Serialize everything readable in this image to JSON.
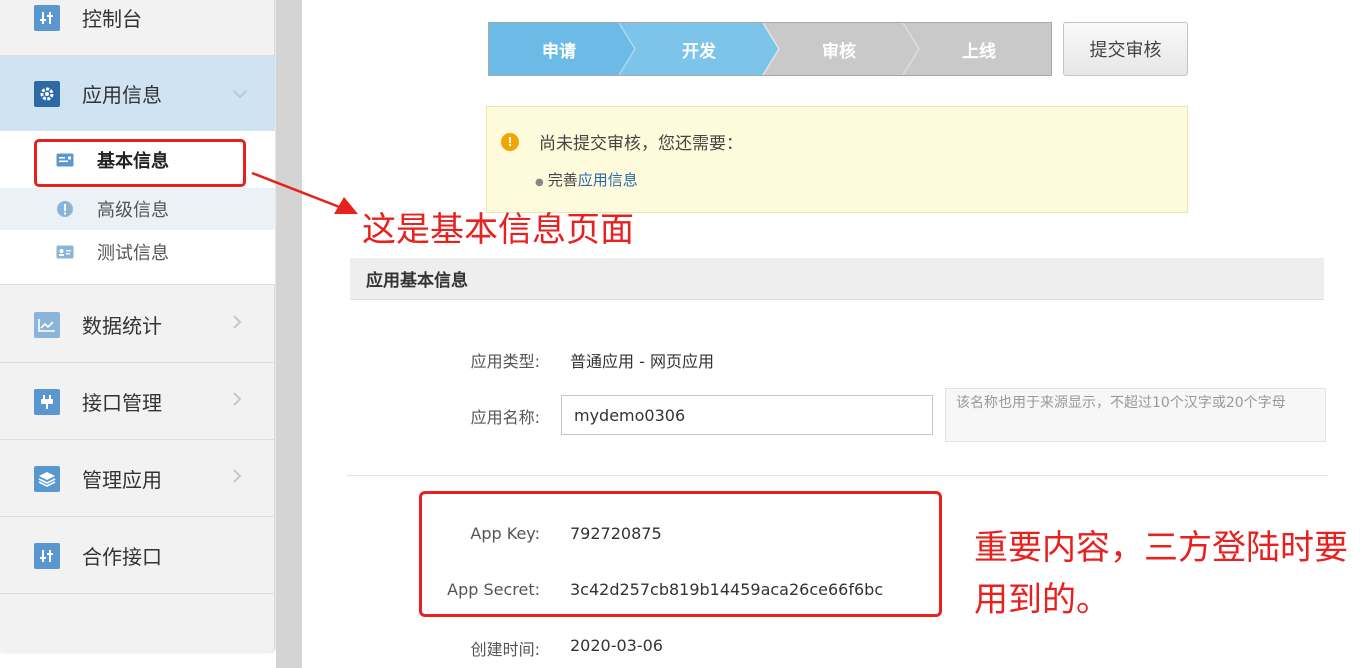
{
  "sidebar": {
    "items": [
      {
        "label": "控制台",
        "icon": "sliders-icon"
      },
      {
        "label": "应用信息",
        "icon": "gear-icon"
      },
      {
        "label": "数据统计",
        "icon": "chart-icon"
      },
      {
        "label": "接口管理",
        "icon": "plug-icon"
      },
      {
        "label": "管理应用",
        "icon": "layers-icon"
      },
      {
        "label": "合作接口",
        "icon": "sliders-icon"
      }
    ],
    "sub_items": [
      {
        "label": "基本信息",
        "icon": "card-icon"
      },
      {
        "label": "高级信息",
        "icon": "info-icon"
      },
      {
        "label": "测试信息",
        "icon": "id-card-icon"
      }
    ]
  },
  "steps": {
    "items": [
      "申请",
      "开发",
      "审核",
      "上线"
    ],
    "submit_label": "提交审核",
    "active_color": "#6bbbe6",
    "inactive_color": "#c9c9c9"
  },
  "notice": {
    "title": "尚未提交审核，您还需要：",
    "item_prefix": "完善",
    "item_link": "应用信息"
  },
  "annotations": {
    "page_note": "这是基本信息页面",
    "key_note": "重要内容，三方登陆时要用到的。",
    "color": "#e8201e"
  },
  "section": {
    "title": "应用基本信息",
    "type_label": "应用类型:",
    "type_value": "普通应用  -  网页应用",
    "name_label": "应用名称:",
    "name_value": "mydemo0306",
    "name_hint": "该名称也用于来源显示，不超过10个汉字或20个字母",
    "key_label": "App Key:",
    "key_value": "792720875",
    "secret_label": "App Secret:",
    "secret_value": "3c42d257cb819b14459aca26ce66f6bc",
    "created_label": "创建时间:",
    "created_value": "2020-03-06"
  }
}
